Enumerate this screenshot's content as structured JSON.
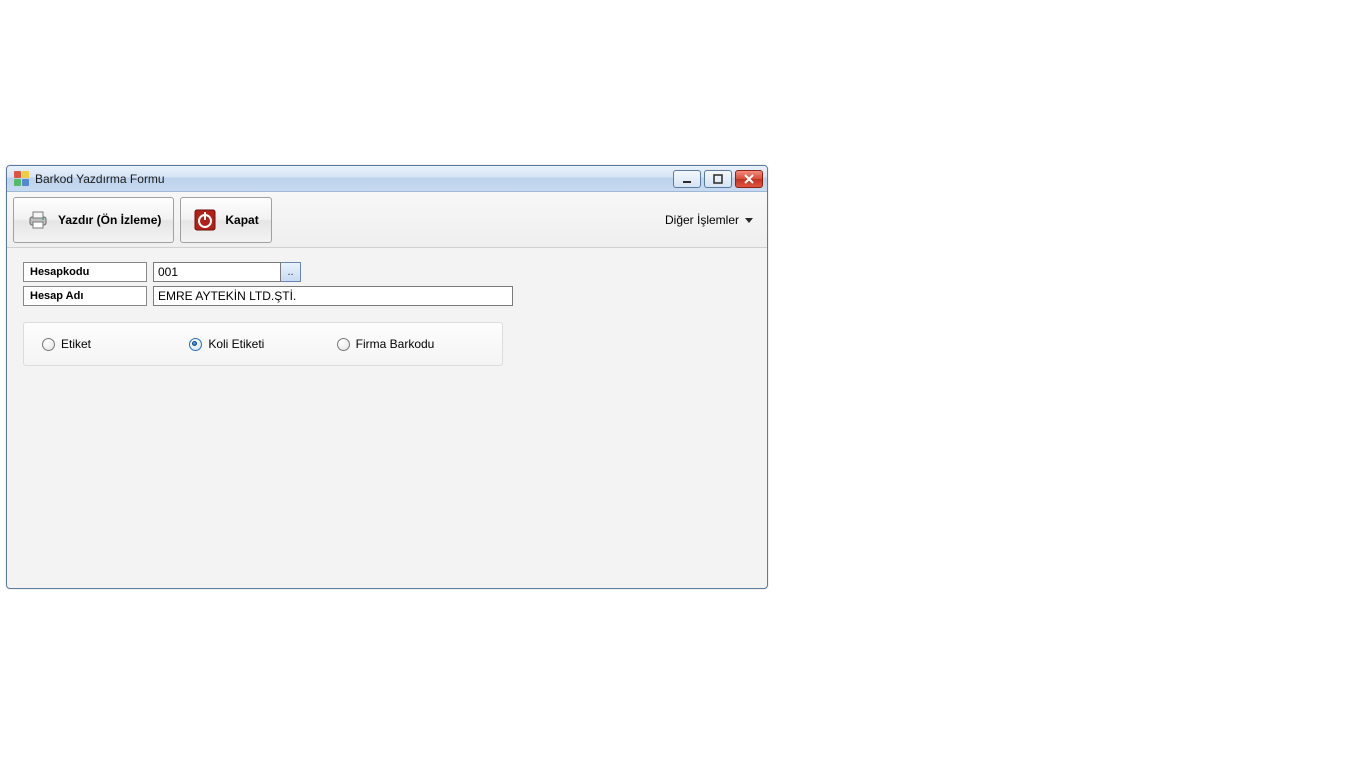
{
  "window": {
    "title": "Barkod Yazdırma Formu"
  },
  "toolbar": {
    "print_preview_label": "Yazdır (Ön İzleme)",
    "close_label": "Kapat",
    "more_ops_label": "Diğer İşlemler"
  },
  "form": {
    "hesap_kodu_label": "Hesapkodu",
    "hesap_kodu_value": "001",
    "lookup_symbol": "..",
    "hesap_adi_label": "Hesap Adı",
    "hesap_adi_value": "EMRE AYTEKİN LTD.ŞTİ."
  },
  "options": {
    "etiket_label": "Etiket",
    "koli_etiketi_label": "Koli Etiketi",
    "firma_barkodu_label": "Firma Barkodu",
    "selected": "koli_etiketi"
  }
}
